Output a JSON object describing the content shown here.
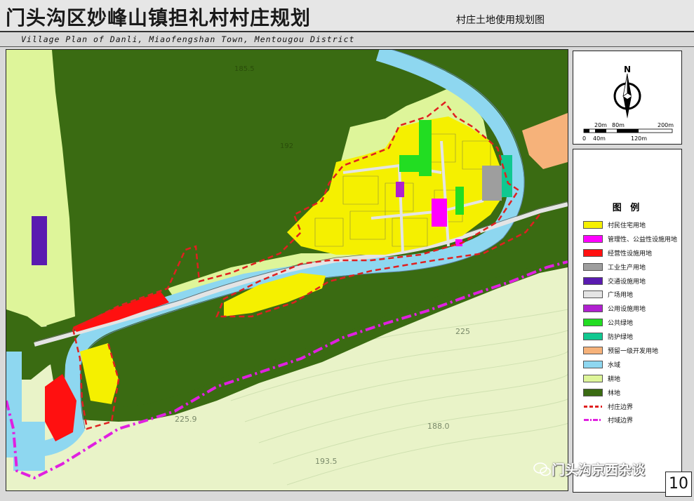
{
  "header": {
    "title": "门头沟区妙峰山镇担礼村村庄规划",
    "subtitle": "村庄土地使用规划图",
    "english_title": "Village Plan of Danli, Miaofengshan Town, Mentougou District"
  },
  "compass": {
    "north_label": "N",
    "scale_top_labels": [
      "20m",
      "80m",
      "200m"
    ],
    "scale_bottom_labels": [
      "0",
      "40m",
      "120m"
    ]
  },
  "legend": {
    "title": "图 例",
    "items": [
      {
        "label": "村民住宅用地",
        "color": "#f5f000",
        "kind": "fill"
      },
      {
        "label": "管理性、公益性设施用地",
        "color": "#ff00ff",
        "kind": "fill"
      },
      {
        "label": "经营性设施用地",
        "color": "#ff1010",
        "kind": "fill"
      },
      {
        "label": "工业生产用地",
        "color": "#9e9e9e",
        "kind": "fill"
      },
      {
        "label": "交通设施用地",
        "color": "#5a1bb0",
        "kind": "fill"
      },
      {
        "label": "广场用地",
        "color": "#e4e4e4",
        "kind": "fill"
      },
      {
        "label": "公用设施用地",
        "color": "#b020d0",
        "kind": "fill"
      },
      {
        "label": "公共绿地",
        "color": "#22dd22",
        "kind": "fill"
      },
      {
        "label": "防护绿地",
        "color": "#10c890",
        "kind": "fill"
      },
      {
        "label": "预留一级开发用地",
        "color": "#f6b27a",
        "kind": "fill"
      },
      {
        "label": "水域",
        "color": "#8ed7f0",
        "kind": "fill"
      },
      {
        "label": "耕地",
        "color": "#def59a",
        "kind": "fill"
      },
      {
        "label": "林地",
        "color": "#3a6b12",
        "kind": "fill"
      },
      {
        "label": "村庄边界",
        "color": "#e02020",
        "kind": "dash"
      },
      {
        "label": "村域边界",
        "color": "#e020e0",
        "kind": "dashdot"
      }
    ]
  },
  "map_labels": {
    "elev_1": "225",
    "elev_2": "225.9",
    "elev_3": "188.0",
    "elev_4": "193.5",
    "elev_5": "192",
    "elev_6": "185.5"
  },
  "watermark": {
    "text": "门头沟京西杂谈",
    "icon": "wechat-icon"
  },
  "page_number": "10"
}
